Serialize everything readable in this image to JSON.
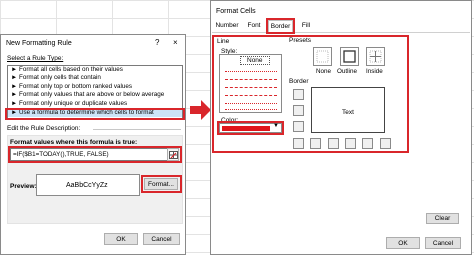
{
  "rule_dialog": {
    "title": "New Formatting Rule",
    "help": "?",
    "close": "×",
    "select_rule_type_label": "Select a Rule Type:",
    "rule_types": [
      "► Format all cells based on their values",
      "► Format only cells that contain",
      "► Format only top or bottom ranked values",
      "► Format only values that are above or below average",
      "► Format only unique or duplicate values",
      "► Use a formula to determine which cells to format"
    ],
    "edit_description_label": "Edit the Rule Description:",
    "formula_label": "Format values where this formula is true:",
    "formula_value": "=IF($B1=TODAY(),TRUE, FALSE)",
    "preview_label": "Preview:",
    "preview_text": "AaBbCcYyZz",
    "format_button": "Format...",
    "ok_button": "OK",
    "cancel_button": "Cancel"
  },
  "arrow_color": "#d9262b",
  "highlight_color": "#d9262b",
  "cells_dialog": {
    "title": "Format Cells",
    "tabs": [
      "Number",
      "Font",
      "Border",
      "Fill"
    ],
    "active_tab": "Border",
    "line_label": "Line",
    "style_label": "Style:",
    "none_label": "None",
    "color_label": "Color:",
    "color_value": "#e0161b",
    "presets_label": "Presets",
    "presets": [
      "None",
      "Outline",
      "Inside"
    ],
    "border_label": "Border",
    "border_preview_text": "Text",
    "clear_button": "Clear",
    "ok_button": "OK",
    "cancel_button": "Cancel"
  }
}
